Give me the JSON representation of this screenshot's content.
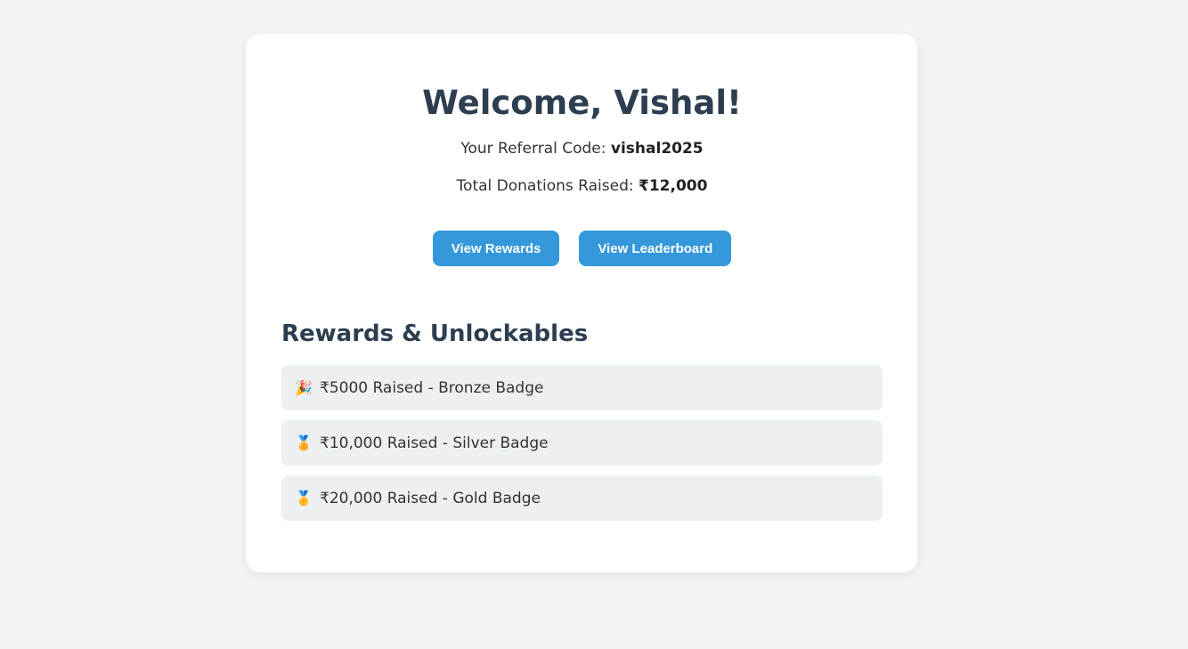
{
  "header": {
    "title": "Welcome, Vishal!",
    "referral_label": "Your Referral Code: ",
    "referral_code": "vishal2025",
    "total_label": "Total Donations Raised: ",
    "total_value": "₹12,000"
  },
  "actions": {
    "rewards_label": "View Rewards",
    "leaderboard_label": "View Leaderboard",
    "button_color": "#3498db"
  },
  "rewards_section": {
    "title": "Rewards & Unlockables",
    "items": [
      {
        "icon": "party-popper-icon",
        "glyph": "🎉",
        "text": "₹5000 Raised - Bronze Badge"
      },
      {
        "icon": "medal-ribbon-icon",
        "glyph": "🏅",
        "text": "₹10,000 Raised - Silver Badge"
      },
      {
        "icon": "first-place-medal-icon",
        "glyph": "🥇",
        "text": "₹20,000 Raised - Gold Badge"
      }
    ]
  }
}
